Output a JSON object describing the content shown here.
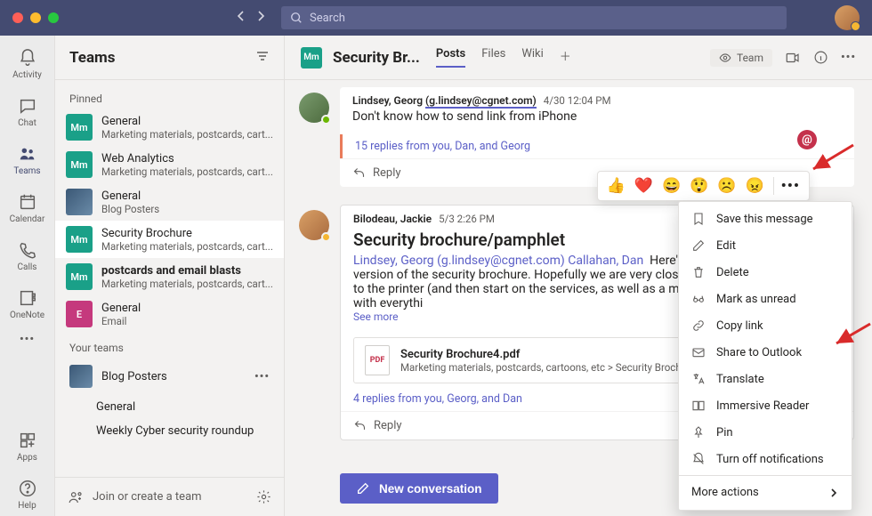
{
  "search": {
    "placeholder": "Search"
  },
  "rail": {
    "items": [
      {
        "id": "activity",
        "label": "Activity"
      },
      {
        "id": "chat",
        "label": "Chat"
      },
      {
        "id": "teams",
        "label": "Teams"
      },
      {
        "id": "calendar",
        "label": "Calendar"
      },
      {
        "id": "calls",
        "label": "Calls"
      },
      {
        "id": "onenote",
        "label": "OneNote"
      }
    ],
    "apps_label": "Apps",
    "help_label": "Help"
  },
  "sidebar": {
    "title": "Teams",
    "pinned_label": "Pinned",
    "channels": [
      {
        "avatar": "Mm",
        "color": "teal",
        "name": "General",
        "sub": "Marketing materials, postcards, cart..."
      },
      {
        "avatar": "Mm",
        "color": "teal",
        "name": "Web Analytics",
        "sub": "Marketing materials, postcards, cart..."
      },
      {
        "avatar": "",
        "color": "img",
        "name": "General",
        "sub": "Blog Posters"
      },
      {
        "avatar": "Mm",
        "color": "teal",
        "name": "Security Brochure",
        "sub": "Marketing materials, postcards, cart..."
      },
      {
        "avatar": "Mm",
        "color": "teal",
        "name": "postcards and email blasts",
        "sub": "Marketing materials, postcards, cart..."
      },
      {
        "avatar": "E",
        "color": "mag",
        "name": "General",
        "sub": "Email"
      }
    ],
    "your_teams_label": "Your teams",
    "team_name": "Blog Posters",
    "team_channels": [
      "General",
      "Weekly Cyber security roundup"
    ],
    "join_label": "Join or create a team"
  },
  "channel": {
    "avatar": "Mm",
    "title": "Security Br...",
    "tabs": [
      "Posts",
      "Files",
      "Wiki"
    ],
    "team_pill": "Team"
  },
  "thread1": {
    "author": "Lindsey, Georg",
    "email": "(g.lindsey@cgnet.com)",
    "timestamp": "4/30 12:04 PM",
    "body": "Don't know how to send link from iPhone",
    "replies": "15 replies from you, Dan, and Georg",
    "reply_label": "Reply"
  },
  "thread2": {
    "author": "Bilodeau, Jackie",
    "timestamp": "5/3 2:26 PM",
    "title": "Security brochure/pamphlet",
    "mentions": "Lindsey, Georg (g.lindsey@cgnet.com) Callahan, Dan",
    "body_start": "Here's a p",
    "body_rest": "version of the security brochure.   Hopefully we are very close t finalized so I can get it off to the printer (and then start on the services, as well as a multipage \"master\" brochure with everythi",
    "seemore": "See more",
    "attachment_name": "Security Brochure4.pdf",
    "attachment_path": "Marketing materials, postcards, cartoons, etc > Security Brochur",
    "replies": "4 replies from you, Georg, and Dan",
    "reply_label": "Reply"
  },
  "reactions": [
    "👍",
    "❤️",
    "😄",
    "😲",
    "☹️",
    "😠"
  ],
  "menu": {
    "items": [
      "Save this message",
      "Edit",
      "Delete",
      "Mark as unread",
      "Copy link",
      "Share to Outlook",
      "Translate",
      "Immersive Reader",
      "Pin",
      "Turn off notifications"
    ],
    "more": "More actions"
  },
  "newconv_label": "New conversation"
}
